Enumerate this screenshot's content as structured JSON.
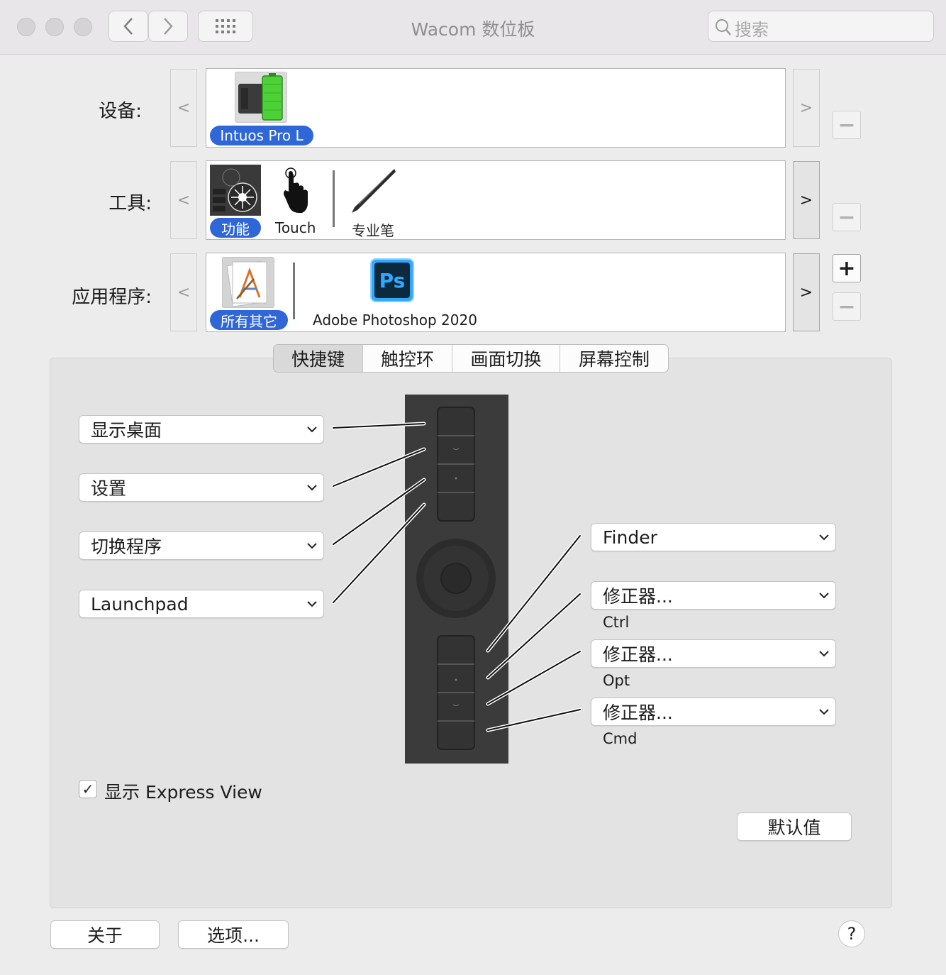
{
  "window": {
    "title": "Wacom 数位板"
  },
  "toolbar": {
    "back_glyph": "‹",
    "forward_glyph": "›",
    "search_placeholder": "搜索"
  },
  "rows": {
    "device": {
      "label": "设备:",
      "prev_arrow": "<",
      "next_arrow": ">",
      "items": [
        {
          "label": "Intuos Pro L",
          "icon": "tablet-battery-icon",
          "selected": true
        }
      ]
    },
    "tool": {
      "label": "工具:",
      "prev_arrow": "<",
      "next_arrow": ">",
      "items": [
        {
          "label": "功能",
          "icon": "express-keys-icon",
          "selected": true
        },
        {
          "label": "Touch",
          "icon": "touch-hand-icon",
          "selected": false
        },
        {
          "label": "专业笔",
          "icon": "pro-pen-icon",
          "selected": false
        }
      ]
    },
    "application": {
      "label": "应用程序:",
      "prev_arrow": "<",
      "next_arrow": ">",
      "add_glyph": "+",
      "remove_glyph": "−",
      "items": [
        {
          "label": "所有其它",
          "icon": "all-apps-icon",
          "selected": true
        },
        {
          "label": "Adobe Photoshop 2020",
          "icon": "photoshop-icon",
          "icon_text": "Ps",
          "selected": false
        }
      ]
    }
  },
  "tabs": [
    "快捷键",
    "触控环",
    "画面切换",
    "屏幕控制"
  ],
  "active_tab": 0,
  "express_keys": {
    "left": [
      "显示桌面",
      "设置",
      "切换程序",
      "Launchpad"
    ],
    "right": [
      {
        "value": "Finder",
        "sub": ""
      },
      {
        "value": "修正器...",
        "sub": "Ctrl"
      },
      {
        "value": "修正器...",
        "sub": "Opt"
      },
      {
        "value": "修正器...",
        "sub": "Cmd"
      }
    ]
  },
  "express_view": {
    "label": "显示 Express View",
    "checked": true,
    "check_glyph": "✓"
  },
  "buttons": {
    "defaults": "默认值",
    "about": "关于",
    "options": "选项...",
    "help": "?"
  },
  "colors": {
    "selection_blue": "#2f67d8",
    "tablet_dark": "#3b3b3b",
    "battery_green": "#4cd137",
    "photoshop_bg": "#0c2a3e",
    "photoshop_accent": "#31a8ff"
  }
}
